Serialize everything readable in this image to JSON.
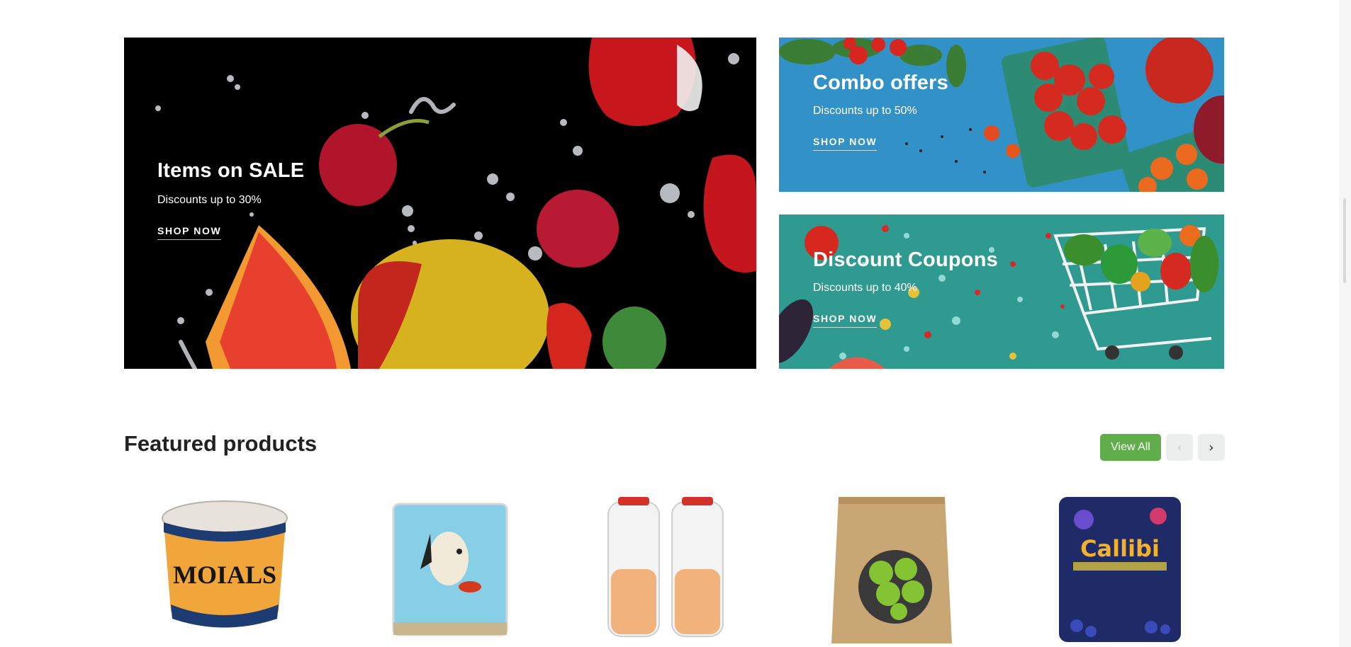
{
  "banners": {
    "main": {
      "title": "Items on SALE",
      "subtitle": "Discounts up to 30%",
      "link": "SHOP NOW"
    },
    "combo": {
      "title": "Combo offers",
      "subtitle": "Discounts up to 50%",
      "link": "SHOP NOW"
    },
    "coupon": {
      "title": "Discount Coupons",
      "subtitle": "Discounts up to 40%",
      "link": "SHOP NOW"
    }
  },
  "featured": {
    "title": "Featured products",
    "view_all": "View All",
    "prev_icon": "chevron-left-icon",
    "next_icon": "chevron-right-icon",
    "products": [
      {
        "name": "tub-product",
        "label": "MOIALS"
      },
      {
        "name": "dog-food-product",
        "label": ""
      },
      {
        "name": "jar-product",
        "label": ""
      },
      {
        "name": "green-olives-bag-product",
        "label": ""
      },
      {
        "name": "blueberry-pack-product",
        "label": "Callibi"
      }
    ]
  },
  "colors": {
    "accent": "#5fae4b",
    "nav_bg": "#eceeee",
    "title": "#222222"
  }
}
